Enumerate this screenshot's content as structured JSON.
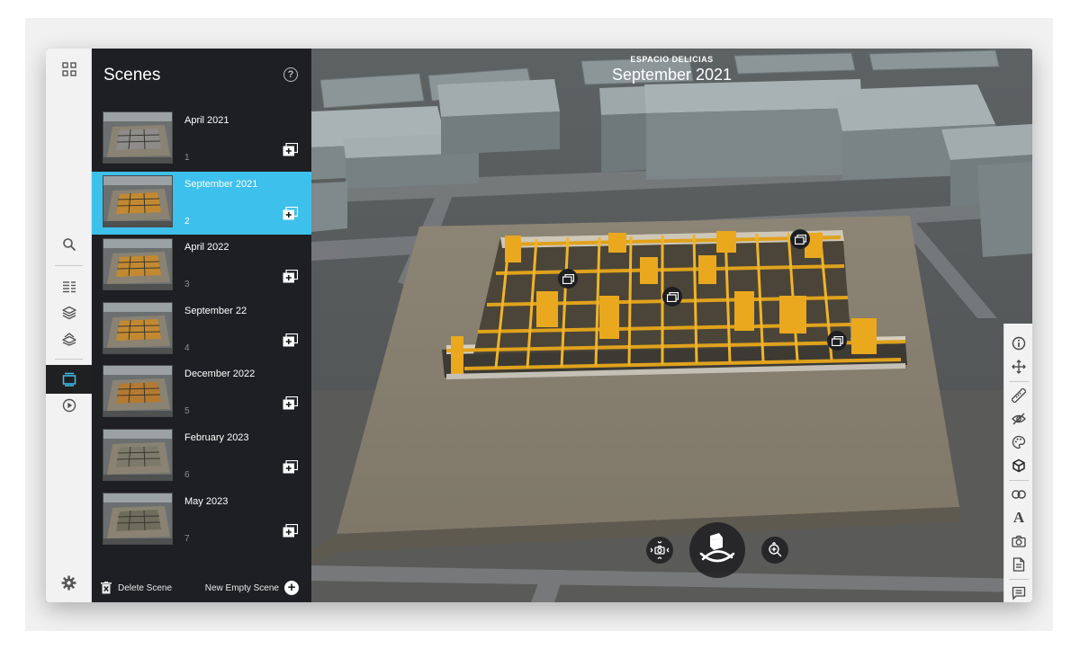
{
  "panel": {
    "title": "Scenes",
    "help_symbol": "?",
    "scenes": [
      {
        "name": "April 2021",
        "number": "1",
        "active": false,
        "thumb_color": "#8d8d8d"
      },
      {
        "name": "September 2021",
        "number": "2",
        "active": true,
        "thumb_color": "#c98a2a"
      },
      {
        "name": "April 2022",
        "number": "3",
        "active": false,
        "thumb_color": "#c98a2a"
      },
      {
        "name": "September 22",
        "number": "4",
        "active": false,
        "thumb_color": "#c98a2a"
      },
      {
        "name": "December 2022",
        "number": "5",
        "active": false,
        "thumb_color": "#b8792a"
      },
      {
        "name": "February 2023",
        "number": "6",
        "active": false,
        "thumb_color": "#7a7a6a"
      },
      {
        "name": "May 2023",
        "number": "7",
        "active": false,
        "thumb_color": "#6a6a5a"
      }
    ],
    "footer": {
      "delete_label": "Delete Scene",
      "new_label": "New Empty Scene"
    }
  },
  "viewport": {
    "project_name": "ESPACIO DELICIAS",
    "scene_title": "September 2021"
  },
  "left_rail_icons": [
    "grid-icon",
    "search-icon",
    "list-icon",
    "layers-icon",
    "terrain-layers-icon",
    "scenes-icon",
    "play-icon",
    "settings-icon"
  ],
  "right_toolbar_icons": [
    "info-icon",
    "move-icon",
    "measure-icon",
    "visibility-icon",
    "palette-icon",
    "cube-icon",
    "link-icon",
    "text-icon",
    "camera-icon",
    "document-icon",
    "comment-icon"
  ],
  "text_tool_label": "A",
  "colors": {
    "accent": "#3ec0ec",
    "panel_bg": "#1e1f22",
    "rail_bg": "#f2f2f2",
    "structure": "#e0a21c",
    "ground": "#8b8373"
  }
}
